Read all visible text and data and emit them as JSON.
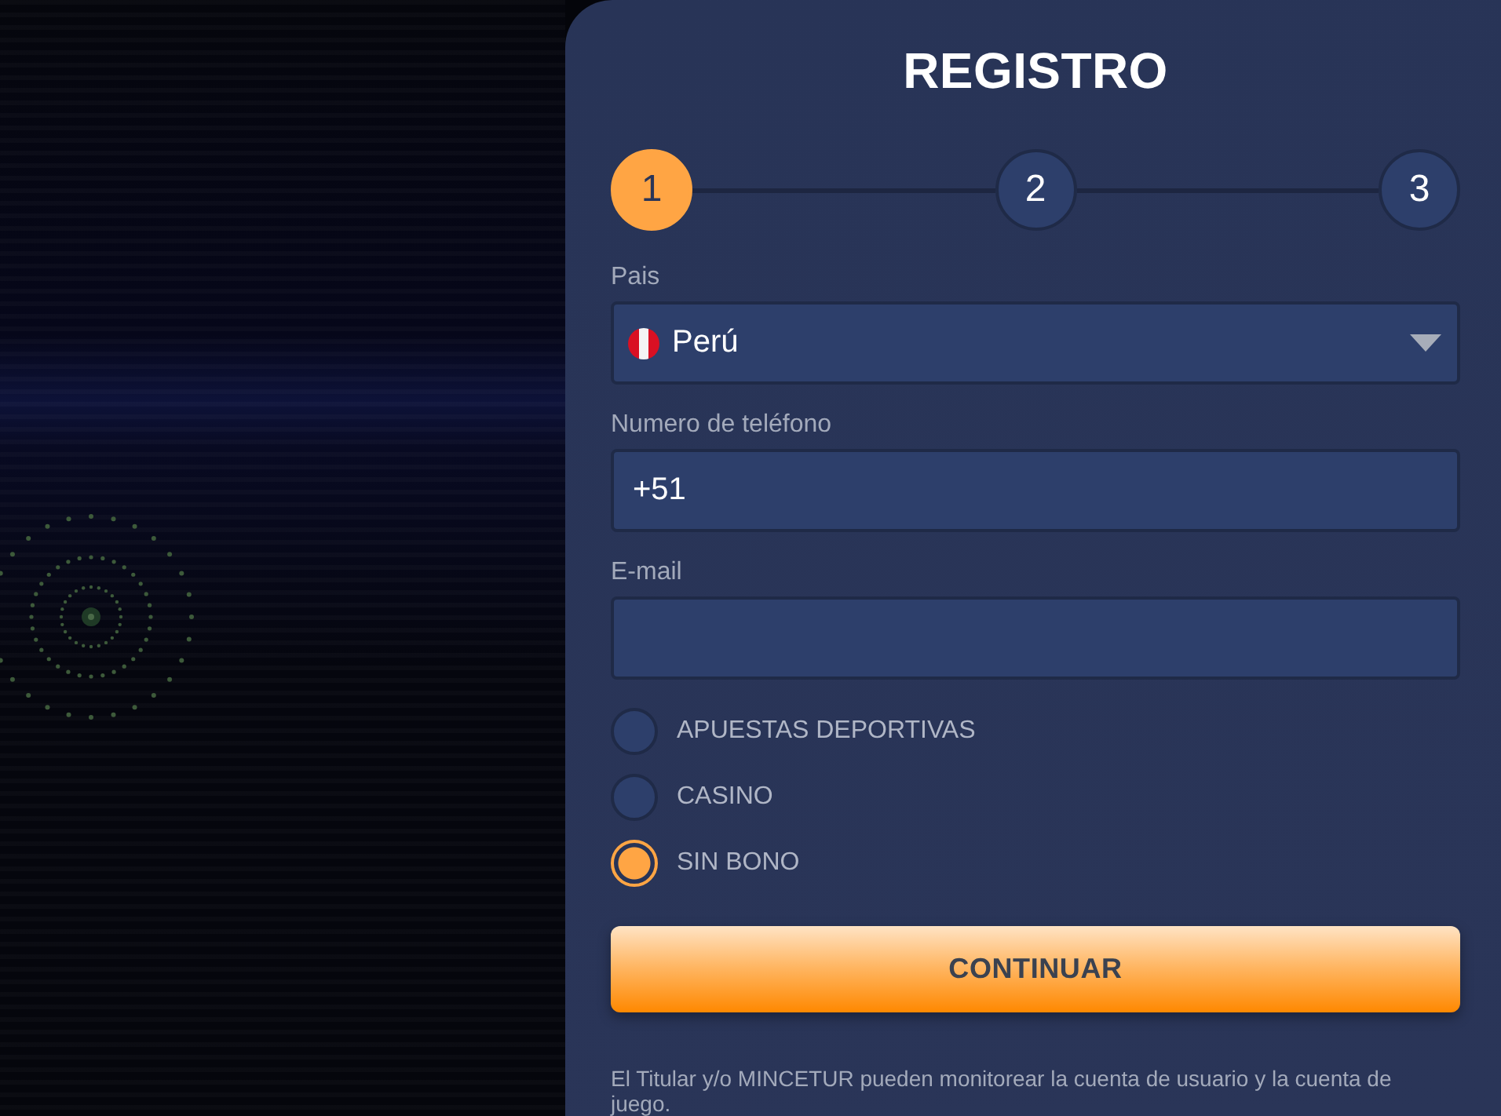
{
  "panel": {
    "title": "REGISTRO"
  },
  "steps": [
    {
      "label": "1",
      "selected": true
    },
    {
      "label": "2",
      "selected": false
    },
    {
      "label": "3",
      "selected": false
    }
  ],
  "fields": [
    {
      "kind": "select",
      "label": "Pais",
      "value": "Perú"
    },
    {
      "kind": "tel",
      "label": "Numero de teléfono",
      "value": "+51"
    },
    {
      "kind": "email",
      "label": "E-mail"
    }
  ],
  "bonus_options": [
    {
      "label": "APUESTAS DEPORTIVAS",
      "selected": false
    },
    {
      "label": "CASINO",
      "selected": false
    },
    {
      "label": "SIN BONO",
      "selected": true
    }
  ],
  "submit_button": "CONTINUAR",
  "notice": "El Titular y/o MINCETUR pueden monitorear la cuenta de usuario y la cuenta de juego."
}
